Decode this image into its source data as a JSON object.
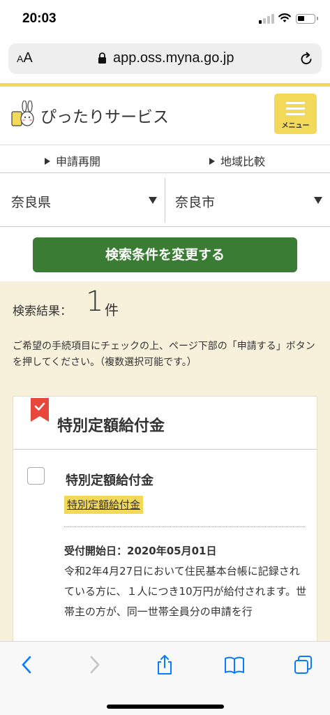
{
  "status_bar": {
    "time": "20:03"
  },
  "address_bar": {
    "text_size_label": "AA",
    "url": "app.oss.myna.go.jp"
  },
  "site_header": {
    "title": "ぴったりサービス",
    "menu_label": "メニュー"
  },
  "sub_nav": {
    "resume_label": "申請再開",
    "compare_label": "地域比較"
  },
  "location": {
    "prefecture": "奈良県",
    "city": "奈良市"
  },
  "search_button_label": "検索条件を変更する",
  "results": {
    "label": "検索結果：",
    "count": "1",
    "unit": "件",
    "instruction": "ご希望の手続項目にチェックの上、ページ下部の「申請する」ボタンを押してください。（複数選択可能です。）"
  },
  "card": {
    "title": "特別定額給付金",
    "item_name": "特別定額給付金",
    "item_tag": "特別定額給付金",
    "start_date": "受付開始日：2020年05月01日",
    "description": "令和2年4月27日において住民基本台帳に記録されている方に、１人につき10万円が給付されます。世帯主の方が、同一世帯全員分の申請を行"
  },
  "colors": {
    "accent_yellow": "#f3d95a",
    "button_green": "#3b7c35",
    "results_bg": "#f7f1dc",
    "ribbon_red": "#e8473b",
    "ios_blue": "#0a7aff"
  },
  "icons": {
    "toolbar": [
      "back-icon",
      "forward-icon",
      "share-icon",
      "bookmarks-icon",
      "tabs-icon"
    ]
  }
}
